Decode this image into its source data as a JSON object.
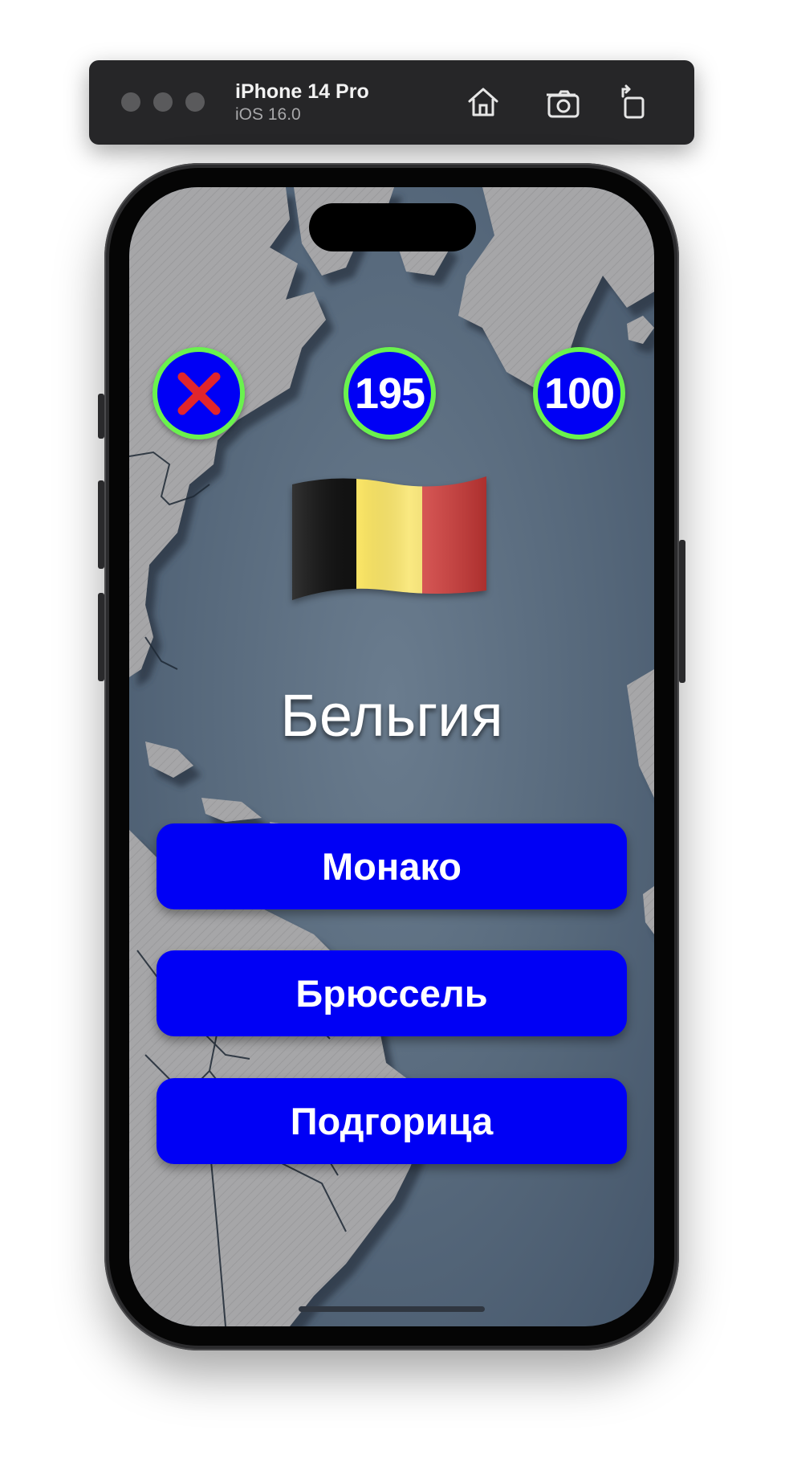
{
  "simulator": {
    "device_name": "iPhone 14 Pro",
    "os_version": "iOS 16.0",
    "icons": [
      "home-icon",
      "screenshot-icon",
      "rotate-icon"
    ]
  },
  "game": {
    "questions_total": "195",
    "score": "100",
    "flag_icon": "belgium-flag-icon",
    "country_name": "Бельгия",
    "answers": [
      "Монако",
      "Брюссель",
      "Подгорица"
    ]
  },
  "colors": {
    "accent_blue": "#0000f5",
    "ring_green": "#6af24e",
    "close_red": "#e1252b",
    "map_water": "#56687b",
    "map_land": "#a6a6a8"
  }
}
